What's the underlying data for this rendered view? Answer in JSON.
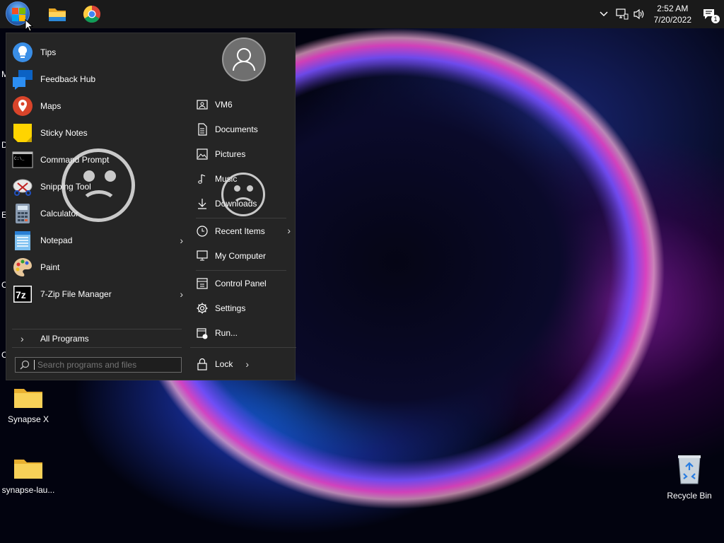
{
  "taskbar": {
    "pinned": [
      {
        "name": "file-explorer"
      },
      {
        "name": "chrome"
      }
    ],
    "clock": {
      "time": "2:52 AM",
      "date": "7/20/2022"
    },
    "notifications_count": "1"
  },
  "start_menu": {
    "apps": [
      {
        "label": "Tips",
        "has_submenu": false
      },
      {
        "label": "Feedback Hub",
        "has_submenu": false
      },
      {
        "label": "Maps",
        "has_submenu": false
      },
      {
        "label": "Sticky Notes",
        "has_submenu": false
      },
      {
        "label": "Command Prompt",
        "has_submenu": false
      },
      {
        "label": "Snipping Tool",
        "has_submenu": false
      },
      {
        "label": "Calculator",
        "has_submenu": false
      },
      {
        "label": "Notepad",
        "has_submenu": true
      },
      {
        "label": "Paint",
        "has_submenu": false
      },
      {
        "label": "7-Zip File Manager",
        "has_submenu": true
      }
    ],
    "all_programs_label": "All Programs",
    "search_placeholder": "Search programs and files",
    "places": [
      {
        "label": "VM6",
        "icon": "user-folder-icon"
      },
      {
        "label": "Documents",
        "icon": "document-icon"
      },
      {
        "label": "Pictures",
        "icon": "picture-icon"
      },
      {
        "label": "Music",
        "icon": "music-icon"
      },
      {
        "label": "Downloads",
        "icon": "download-icon"
      },
      {
        "label": "Recent Items",
        "icon": "clock-icon",
        "has_submenu": true
      },
      {
        "label": "My Computer",
        "icon": "computer-icon"
      },
      {
        "label": "Control Panel",
        "icon": "control-panel-icon"
      },
      {
        "label": "Settings",
        "icon": "gear-icon"
      },
      {
        "label": "Run...",
        "icon": "run-icon"
      }
    ],
    "lock_label": "Lock"
  },
  "desktop": {
    "icons": [
      {
        "label": "Synapse X",
        "type": "folder"
      },
      {
        "label": "synapse-lau...",
        "type": "folder"
      },
      {
        "label": "Recycle Bin",
        "type": "recycle-bin"
      }
    ],
    "edge_letters": [
      "M",
      "D",
      "E",
      "C",
      "C"
    ]
  }
}
